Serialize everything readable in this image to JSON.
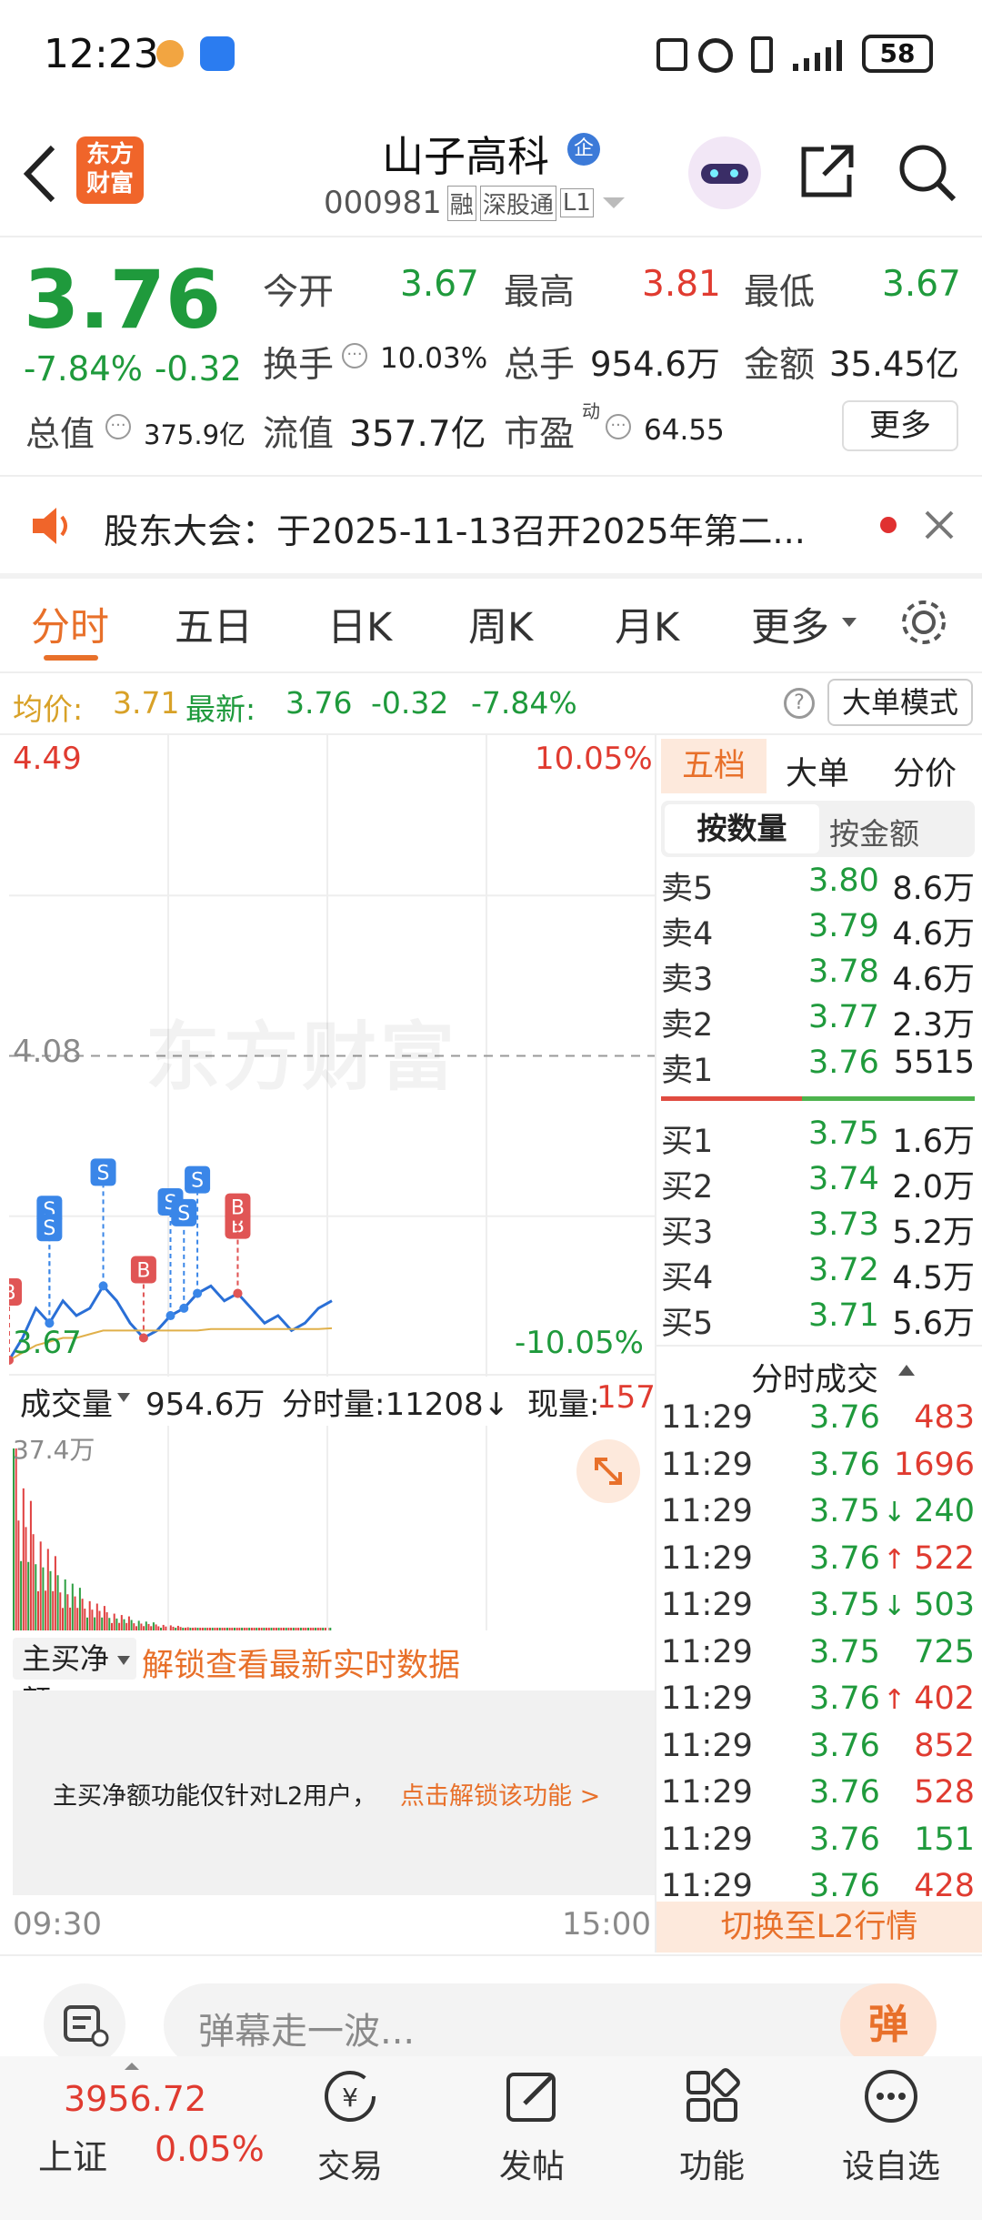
{
  "status_bar": {
    "time": "12:23",
    "battery": "58"
  },
  "header": {
    "stock_name": "山子高科",
    "badge": "企",
    "code": "000981",
    "tags": [
      "融",
      "深股通",
      "L1"
    ],
    "logo_line1": "东方",
    "logo_line2": "财富"
  },
  "quote": {
    "price": "3.76",
    "change_pct": "-7.84%",
    "change": "-0.32",
    "stats": [
      {
        "label": "今开",
        "value": "3.67"
      },
      {
        "label": "最高",
        "value": "3.81"
      },
      {
        "label": "最低",
        "value": "3.67"
      },
      {
        "label": "换手",
        "value": "10.03%"
      },
      {
        "label": "总手",
        "value": "954.6万"
      },
      {
        "label": "金额",
        "value": "35.45亿"
      },
      {
        "label": "总值",
        "value": "375.9亿"
      },
      {
        "label": "流值",
        "value": "357.7亿"
      },
      {
        "label": "市盈",
        "value": "64.55",
        "sup": "动"
      }
    ],
    "more_button": "更多"
  },
  "notice": {
    "text": "股东大会：于2025-11-13召开2025年第二..."
  },
  "tabs": [
    "分时",
    "五日",
    "日K",
    "周K",
    "月K",
    "更多"
  ],
  "info_line": {
    "avg_label": "均价:",
    "avg": "3.71",
    "latest_label": "最新:",
    "latest": "3.76",
    "change": "-0.32",
    "change_pct": "-7.84%",
    "mode_button": "大单模式"
  },
  "chart": {
    "y_max": "4.49",
    "y_mid": "4.08",
    "y_min": "3.67",
    "pct_max": "10.05%",
    "pct_min": "-10.05%",
    "watermark": "东方财富",
    "time_start": "09:30",
    "time_end": "15:00",
    "volume_label": "成交量",
    "volume_total": "954.6万",
    "tick_label": "分时量:11208↓",
    "now_label": "现量:",
    "now_value": "157",
    "volume_max": "37.4万",
    "net_buy_label": "主买净额",
    "unlock_link": "解锁查看最新实时数据",
    "locked_text": "主买净额功能仅针对L2用户，",
    "locked_link": "点击解锁该功能 >",
    "markers": [
      "S",
      "S",
      "S",
      "S",
      "S",
      "S",
      "B",
      "B",
      "B",
      "B"
    ]
  },
  "chart_data": {
    "type": "line",
    "title": "",
    "x_range": [
      "09:30",
      "15:00"
    ],
    "ylim": [
      3.67,
      4.49
    ],
    "prev_close": 4.08,
    "series": [
      {
        "name": "",
        "color": "#2a6fd6",
        "values": [
          3.67,
          3.7,
          3.74,
          3.72,
          3.75,
          3.73,
          3.74,
          3.77,
          3.75,
          3.72,
          3.7,
          3.71,
          3.73,
          3.74,
          3.76,
          3.77,
          3.75,
          3.76,
          3.74,
          3.72,
          3.73,
          3.71,
          3.72,
          3.74,
          3.75
        ]
      },
      {
        "name": "",
        "color": "#e0b04a",
        "values": [
          3.67,
          3.68,
          3.69,
          3.695,
          3.7,
          3.7,
          3.705,
          3.71,
          3.71,
          3.71,
          3.71,
          3.71,
          3.71,
          3.71,
          3.71,
          3.712,
          3.712,
          3.712,
          3.712,
          3.712,
          3.712,
          3.712,
          3.712,
          3.712,
          3.713
        ]
      }
    ]
  },
  "order_book": {
    "tabs": [
      "五档",
      "大单",
      "分价"
    ],
    "sub_tabs": [
      "按数量",
      "按金额"
    ],
    "asks": [
      {
        "label": "卖5",
        "price": "3.80",
        "vol": "8.6万"
      },
      {
        "label": "卖4",
        "price": "3.79",
        "vol": "4.6万"
      },
      {
        "label": "卖3",
        "price": "3.78",
        "vol": "4.6万"
      },
      {
        "label": "卖2",
        "price": "3.77",
        "vol": "2.3万"
      },
      {
        "label": "卖1",
        "price": "3.76",
        "vol": "5515"
      }
    ],
    "bids": [
      {
        "label": "买1",
        "price": "3.75",
        "vol": "1.6万"
      },
      {
        "label": "买2",
        "price": "3.74",
        "vol": "2.0万"
      },
      {
        "label": "买3",
        "price": "3.73",
        "vol": "5.2万"
      },
      {
        "label": "买4",
        "price": "3.72",
        "vol": "4.5万"
      },
      {
        "label": "买5",
        "price": "3.71",
        "vol": "5.6万"
      }
    ]
  },
  "trades": {
    "title": "分时成交",
    "rows": [
      {
        "time": "11:29",
        "price": "3.76",
        "arrow": "",
        "vol": "483",
        "c": "red"
      },
      {
        "time": "11:29",
        "price": "3.76",
        "arrow": "",
        "vol": "1696",
        "c": "red"
      },
      {
        "time": "11:29",
        "price": "3.75",
        "arrow": "↓",
        "vol": "240",
        "c": "green"
      },
      {
        "time": "11:29",
        "price": "3.76",
        "arrow": "↑",
        "vol": "522",
        "c": "red"
      },
      {
        "time": "11:29",
        "price": "3.75",
        "arrow": "↓",
        "vol": "503",
        "c": "green"
      },
      {
        "time": "11:29",
        "price": "3.75",
        "arrow": "",
        "vol": "725",
        "c": "green"
      },
      {
        "time": "11:29",
        "price": "3.76",
        "arrow": "↑",
        "vol": "402",
        "c": "red"
      },
      {
        "time": "11:29",
        "price": "3.76",
        "arrow": "",
        "vol": "852",
        "c": "red"
      },
      {
        "time": "11:29",
        "price": "3.76",
        "arrow": "",
        "vol": "528",
        "c": "red"
      },
      {
        "time": "11:29",
        "price": "3.76",
        "arrow": "",
        "vol": "151",
        "c": "green"
      },
      {
        "time": "11:29",
        "price": "3.76",
        "arrow": "",
        "vol": "428",
        "c": "red"
      }
    ],
    "switch_l2": "切换至L2行情"
  },
  "comment_bar": {
    "placeholder": "弹幕走一波...",
    "danmu": "弹"
  },
  "bottom_nav": {
    "index_value": "3956.72",
    "index_name": "上证",
    "index_change": "0.05%",
    "items": [
      "交易",
      "发帖",
      "功能",
      "设自选"
    ]
  }
}
